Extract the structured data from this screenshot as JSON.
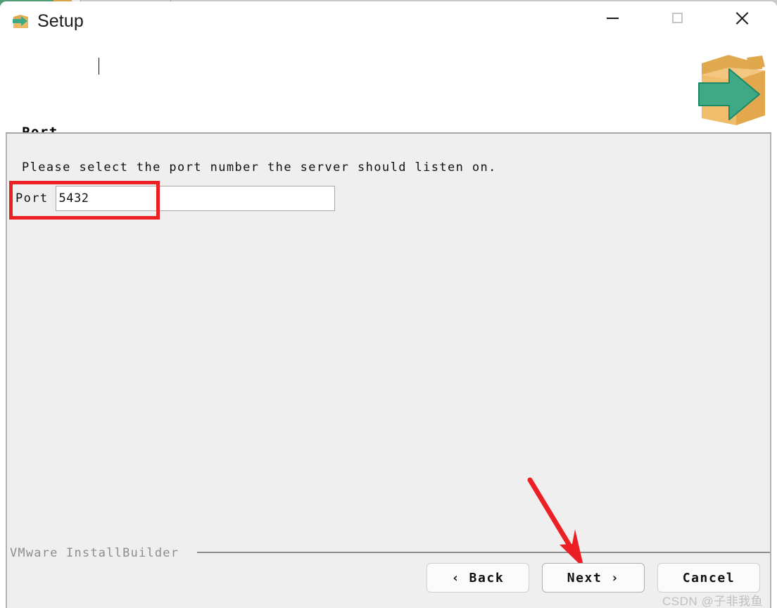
{
  "window": {
    "title": "Setup",
    "icon": "installer-box-arrow-icon",
    "controls": {
      "minimize": "–",
      "maximize": "□",
      "close": "✕"
    }
  },
  "header": {
    "page_title": "Port",
    "art_icon": "open-box-with-green-arrow-graphic"
  },
  "main": {
    "instruction": "Please select the port number the server should listen on.",
    "port_field": {
      "label": "Port",
      "value": "5432",
      "placeholder": ""
    }
  },
  "annotations": {
    "field_highlight_color": "#ec2024",
    "arrow_color": "#ec2024",
    "arrow_target": "next-button"
  },
  "footer": {
    "brand": "VMware InstallBuilder",
    "buttons": {
      "back": "‹ Back",
      "next": "Next ›",
      "cancel": "Cancel"
    }
  },
  "watermark": {
    "text": "CSDN @子非我鱼"
  },
  "colors": {
    "accent_green": "#3fa884",
    "box_tan": "#eeb964",
    "body_bg": "#efefef",
    "titlebar_bg": "#ffffff"
  }
}
